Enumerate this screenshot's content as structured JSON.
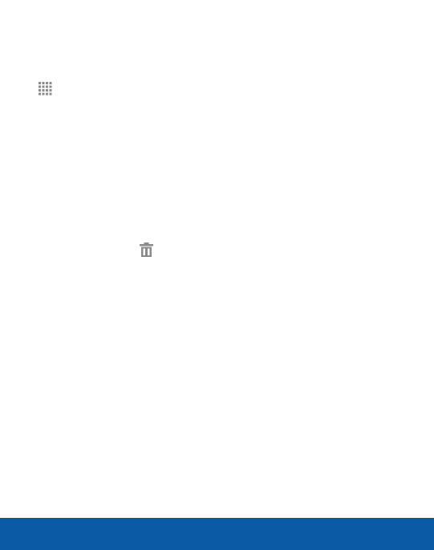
{
  "icons": {
    "apps": "apps-grid-icon",
    "delete": "trash-icon"
  },
  "colors": {
    "icon_gray": "#8a8a8a",
    "footer_blue": "#0a5aa6",
    "background": "#ffffff"
  }
}
